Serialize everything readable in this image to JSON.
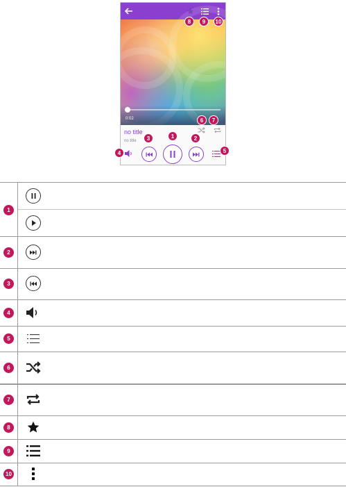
{
  "player": {
    "song_title": "no title",
    "artist": "no title",
    "elapsed_time": "0:02",
    "progress": 0.0,
    "accent_color": "#8a3fcf"
  },
  "callouts": [
    "1",
    "2",
    "3",
    "4",
    "5",
    "6",
    "7",
    "8",
    "9",
    "10"
  ],
  "legend": [
    {
      "num": "1",
      "icons": [
        "pause-icon",
        "play-icon"
      ]
    },
    {
      "num": "2",
      "icons": [
        "next-track-icon"
      ]
    },
    {
      "num": "3",
      "icons": [
        "previous-track-icon"
      ]
    },
    {
      "num": "4",
      "icons": [
        "volume-icon"
      ]
    },
    {
      "num": "5",
      "icons": [
        "playlist-icon"
      ]
    },
    {
      "num": "6",
      "icons": [
        "shuffle-icon"
      ]
    },
    {
      "num": "7",
      "icons": [
        "repeat-icon"
      ]
    },
    {
      "num": "8",
      "icons": [
        "favorite-star-icon"
      ]
    },
    {
      "num": "9",
      "icons": [
        "queue-list-icon"
      ]
    },
    {
      "num": "10",
      "icons": [
        "more-options-icon"
      ]
    }
  ],
  "colors": {
    "callout": "#c2185b",
    "appbar": "#8a3fcf"
  }
}
